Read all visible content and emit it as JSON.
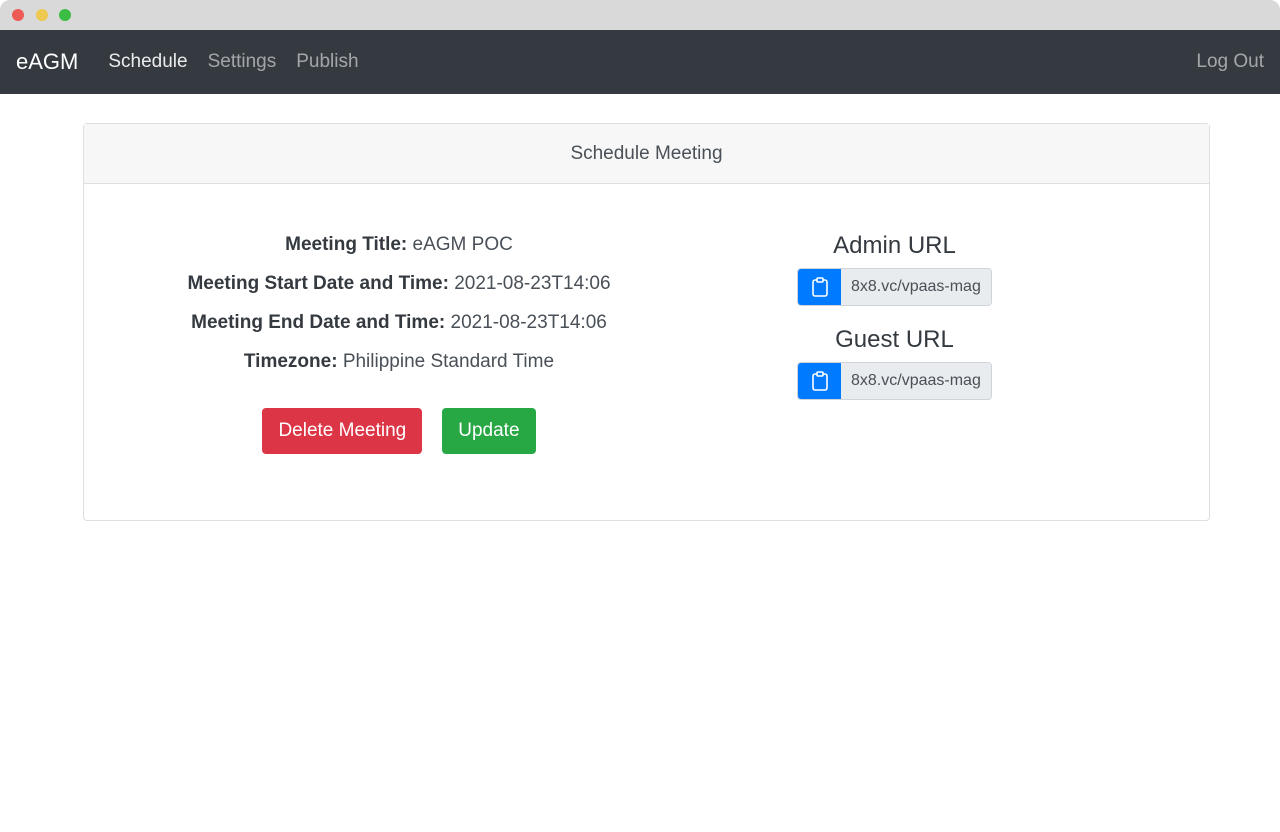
{
  "nav": {
    "brand": "eAGM",
    "links": [
      "Schedule",
      "Settings",
      "Publish"
    ],
    "logout": "Log Out"
  },
  "card": {
    "title": "Schedule Meeting",
    "fields": [
      {
        "label": "Meeting Title:",
        "value": "eAGM POC"
      },
      {
        "label": "Meeting Start Date and Time:",
        "value": "2021-08-23T14:06"
      },
      {
        "label": "Meeting End Date and Time:",
        "value": "2021-08-23T14:06"
      },
      {
        "label": "Timezone:",
        "value": "Philippine Standard Time"
      }
    ],
    "delete_label": "Delete Meeting",
    "update_label": "Update",
    "admin": {
      "heading": "Admin URL",
      "value": "8x8.vc/vpaas-mag"
    },
    "guest": {
      "heading": "Guest URL",
      "value": "8x8.vc/vpaas-mag"
    }
  },
  "colors": {
    "danger": "#dc3545",
    "success": "#28a745",
    "primary": "#007bff",
    "navbar": "#343a40"
  }
}
